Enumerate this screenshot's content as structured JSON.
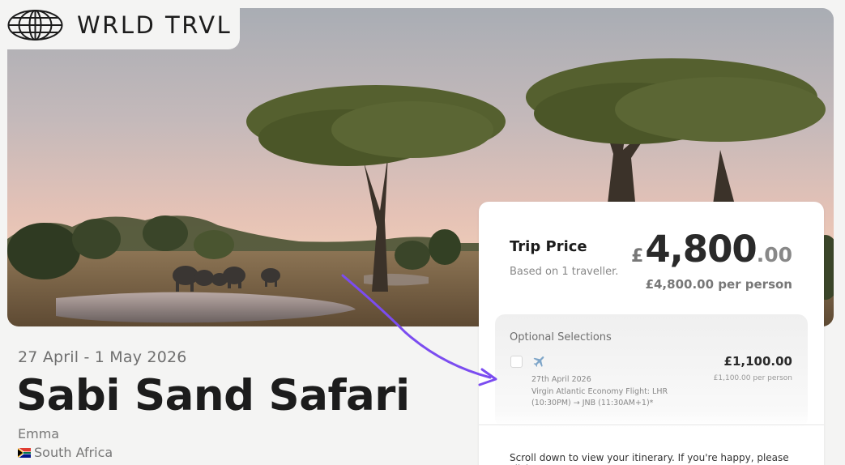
{
  "brand": {
    "name": "WRLD TRVL",
    "icon": "globe-icon"
  },
  "trip": {
    "dates": "27 April - 1 May 2026",
    "title": "Sabi Sand Safari",
    "traveller": "Emma",
    "country": "South Africa",
    "country_flag_icon": "south-africa-flag-icon"
  },
  "price_card": {
    "label": "Trip Price",
    "sub": "Based on 1 traveller.",
    "currency": "£",
    "amount_whole": "4,800",
    "amount_decimal": ".00",
    "per_person": "£4,800.00 per person"
  },
  "optional": {
    "title": "Optional Selections",
    "items": [
      {
        "icon": "airplane-icon",
        "price": "£1,100.00",
        "price_per": "£1,100.00 per person",
        "date": "27th April 2026",
        "description": "Virgin Atlantic Economy Flight: LHR (10:30PM) → JNB (11:30AM+1)*",
        "checked": false
      }
    ]
  },
  "scroll_note": "Scroll down to view your itinerary. If you're happy, please click",
  "colors": {
    "background": "#f4f4f3",
    "card": "#ffffff",
    "annotation_arrow": "#7b4cf0",
    "text_primary": "#1c1c1c",
    "text_muted": "#777777"
  }
}
